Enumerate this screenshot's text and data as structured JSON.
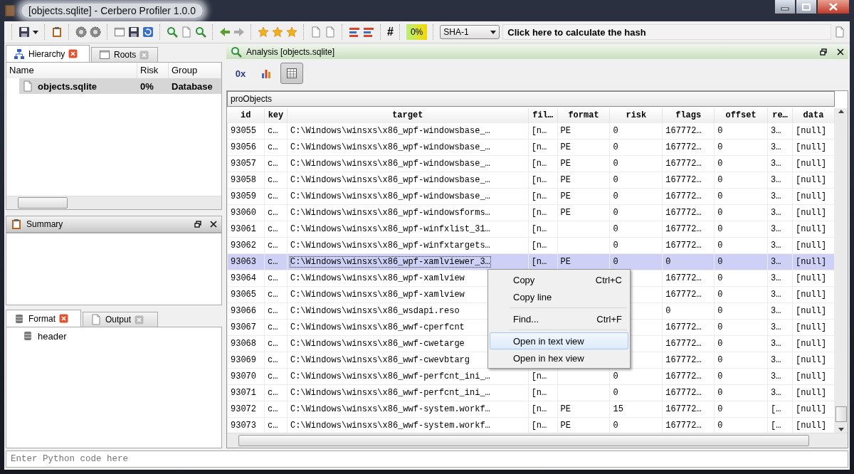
{
  "window": {
    "title": "[objects.sqlite] - Cerbero Profiler 1.0.0"
  },
  "toolbar": {
    "hash_symbol": "#",
    "risk_gauge": "0%",
    "hash_algorithm": "SHA-1",
    "hash_button": "Click here to calculate the hash"
  },
  "left_tabs": [
    {
      "label": "Hierarchy",
      "selected": true
    },
    {
      "label": "Roots",
      "selected": false
    }
  ],
  "hierarchy": {
    "columns": [
      "Name",
      "Risk",
      "Group"
    ],
    "rows": [
      {
        "name": "objects.sqlite",
        "risk": "0%",
        "group": "Database",
        "selected": true
      }
    ]
  },
  "summary": {
    "title": "Summary"
  },
  "bottom_tabs": [
    {
      "label": "Format",
      "selected": true
    },
    {
      "label": "Output",
      "selected": false
    }
  ],
  "format_tree": [
    {
      "label": "header"
    }
  ],
  "analysis": {
    "title": "Analysis [objects.sqlite]",
    "view_buttons": [
      {
        "kind": "text",
        "label": "0x",
        "selected": false
      },
      {
        "kind": "chart",
        "selected": false
      },
      {
        "kind": "table",
        "selected": true
      }
    ],
    "table_name": "proObjects",
    "columns": [
      "id",
      "key",
      "target",
      "fil…",
      "format",
      "risk",
      "flags",
      "offset",
      "re…",
      "data"
    ],
    "rows": [
      {
        "selected": false,
        "cells": [
          "93055",
          "c…",
          "C:\\Windows\\winsxs\\x86_wpf-windowsbase_…",
          "[n…",
          "PE",
          "0",
          "167772…",
          "0",
          "3…",
          "[null]"
        ]
      },
      {
        "selected": false,
        "cells": [
          "93056",
          "c…",
          "C:\\Windows\\winsxs\\x86_wpf-windowsbase_…",
          "[n…",
          "PE",
          "0",
          "167772…",
          "0",
          "3…",
          "[null]"
        ]
      },
      {
        "selected": false,
        "cells": [
          "93057",
          "c…",
          "C:\\Windows\\winsxs\\x86_wpf-windowsbase_…",
          "[n…",
          "PE",
          "0",
          "167772…",
          "0",
          "3…",
          "[null]"
        ]
      },
      {
        "selected": false,
        "cells": [
          "93058",
          "c…",
          "C:\\Windows\\winsxs\\x86_wpf-windowsbase_…",
          "[n…",
          "PE",
          "0",
          "167772…",
          "0",
          "3…",
          "[null]"
        ]
      },
      {
        "selected": false,
        "cells": [
          "93059",
          "c…",
          "C:\\Windows\\winsxs\\x86_wpf-windowsbase_…",
          "[n…",
          "PE",
          "0",
          "167772…",
          "0",
          "3…",
          "[null]"
        ]
      },
      {
        "selected": false,
        "cells": [
          "93060",
          "c…",
          "C:\\Windows\\winsxs\\x86_wpf-windowsforms…",
          "[n…",
          "PE",
          "0",
          "167772…",
          "0",
          "3…",
          "[null]"
        ]
      },
      {
        "selected": false,
        "cells": [
          "93061",
          "c…",
          "C:\\Windows\\winsxs\\x86_wpf-winfxlist_31…",
          "[n…",
          null,
          "0",
          "167772…",
          "0",
          "3…",
          "[null]"
        ]
      },
      {
        "selected": false,
        "cells": [
          "93062",
          "c…",
          "C:\\Windows\\winsxs\\x86_wpf-winfxtargets…",
          "[n…",
          null,
          "0",
          "167772…",
          "0",
          "3…",
          "[null]"
        ]
      },
      {
        "selected": true,
        "cells": [
          "93063",
          "c…",
          "C:\\Windows\\winsxs\\x86_wpf-xamlviewer_3…",
          "[n…",
          "PE",
          "0",
          "0",
          "0",
          "3…",
          "[null]"
        ]
      },
      {
        "selected": false,
        "cells": [
          "93064",
          "c…",
          "C:\\Windows\\winsxs\\x86_wpf-xamlview",
          null,
          null,
          null,
          "167772…",
          "0",
          "3…",
          "[null]"
        ]
      },
      {
        "selected": false,
        "cells": [
          "93065",
          "c…",
          "C:\\Windows\\winsxs\\x86_wpf-xamlview",
          null,
          null,
          null,
          "167772…",
          "0",
          "3…",
          "[null]"
        ]
      },
      {
        "selected": false,
        "cells": [
          "93066",
          "c…",
          "C:\\Windows\\winsxs\\x86_wsdapi.reso",
          null,
          null,
          null,
          "0",
          "0",
          "3…",
          "[null]"
        ]
      },
      {
        "selected": false,
        "cells": [
          "93067",
          "c…",
          "C:\\Windows\\winsxs\\x86_wwf-cperfcnt",
          null,
          null,
          null,
          "167772…",
          "0",
          "3…",
          "[null]"
        ]
      },
      {
        "selected": false,
        "cells": [
          "93068",
          "c…",
          "C:\\Windows\\winsxs\\x86_wwf-cwetarge",
          null,
          null,
          null,
          "167772…",
          "0",
          "3…",
          "[null]"
        ]
      },
      {
        "selected": false,
        "cells": [
          "93069",
          "c…",
          "C:\\Windows\\winsxs\\x86_wwf-cwevbtarg",
          null,
          null,
          null,
          "167772…",
          "0",
          "3…",
          "[null]"
        ]
      },
      {
        "selected": false,
        "cells": [
          "93070",
          "c…",
          "C:\\Windows\\winsxs\\x86_wwf-perfcnt_ini_…",
          "[n…",
          null,
          "0",
          "167772…",
          "0",
          "3…",
          "[null]"
        ]
      },
      {
        "selected": false,
        "cells": [
          "93071",
          "c…",
          "C:\\Windows\\winsxs\\x86_wwf-perfcnt_ini_…",
          "[n…",
          null,
          "0",
          "167772…",
          "0",
          "3…",
          "[null]"
        ]
      },
      {
        "selected": false,
        "cells": [
          "93072",
          "c…",
          "C:\\Windows\\winsxs\\x86_wwf-system.workf…",
          "[n…",
          "PE",
          "15",
          "167772…",
          "0",
          "[…",
          "[null]"
        ]
      },
      {
        "selected": false,
        "cells": [
          "93073",
          "c…",
          "C:\\Windows\\winsxs\\x86_wwf-system.workf…",
          "[n…",
          "PE",
          "0",
          "167772…",
          "0",
          "[…",
          "[null]"
        ]
      }
    ],
    "context_menu": [
      {
        "kind": "item",
        "label": "Copy",
        "shortcut": "Ctrl+C",
        "selected": false
      },
      {
        "kind": "item",
        "label": "Copy line",
        "selected": false
      },
      {
        "kind": "separator"
      },
      {
        "kind": "item",
        "label": "Find...",
        "shortcut": "Ctrl+F",
        "selected": false
      },
      {
        "kind": "separator"
      },
      {
        "kind": "item",
        "label": "Open in text view",
        "selected": true
      },
      {
        "kind": "item",
        "label": "Open in hex view",
        "selected": false
      }
    ]
  },
  "python_console": {
    "placeholder": "Enter Python code here"
  }
}
